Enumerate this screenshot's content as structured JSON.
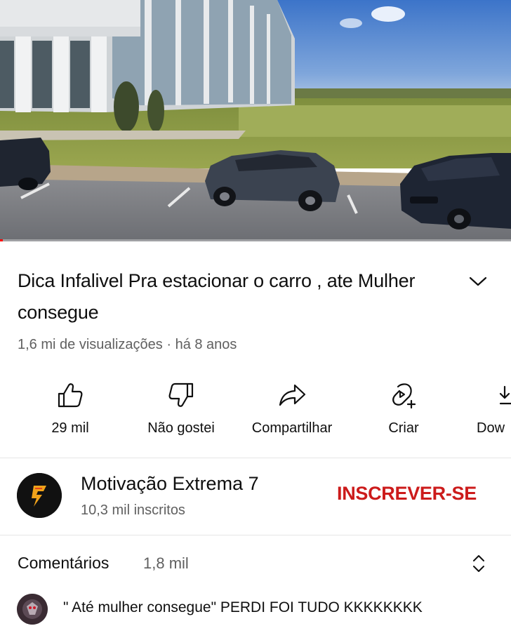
{
  "video": {
    "title": "Dica Infalivel Pra estacionar o carro , ate Mulher consegue",
    "views": "1,6 mi de visualizações",
    "separator": "·",
    "age": "há 8 anos",
    "progress_fraction": 0.005
  },
  "actions": [
    {
      "icon": "thumbs-up-icon",
      "label": "29 mil"
    },
    {
      "icon": "thumbs-down-icon",
      "label": "Não gostei"
    },
    {
      "icon": "share-icon",
      "label": "Compartilhar"
    },
    {
      "icon": "remix-icon",
      "label": "Criar"
    },
    {
      "icon": "download-icon",
      "label": "Dow"
    }
  ],
  "channel": {
    "name": "Motivação Extrema 7",
    "subscribers": "10,3 mil inscritos",
    "subscribe_label": "INSCREVER-SE"
  },
  "comments": {
    "title": "Comentários",
    "count": "1,8 mil",
    "top_comment": "\" Até mulher consegue\" PERDI FOI TUDO KKKKKKKK"
  },
  "colors": {
    "subscribe": "#cc1b1b",
    "progress": "#ff0000",
    "secondary_text": "#606060"
  }
}
